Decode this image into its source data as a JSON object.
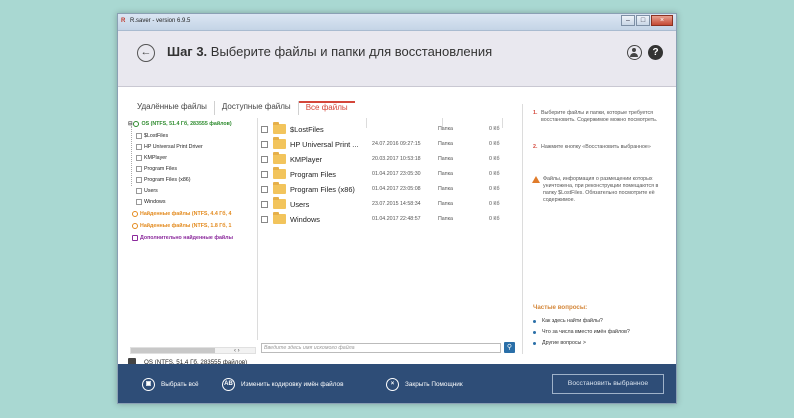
{
  "window": {
    "title": "R.saver - version 6.9.5",
    "logo": "R"
  },
  "header": {
    "step_label": "Шаг 3.",
    "step_text": "Выберите файлы и папки для восстановления"
  },
  "tabs": [
    {
      "label": "Удалённые файлы",
      "active": false
    },
    {
      "label": "Доступные файлы",
      "active": false
    },
    {
      "label": "Все файлы",
      "active": true
    }
  ],
  "tree": {
    "root": "OS (NTFS, 51.4 Гб, 283555 файлов)",
    "children": [
      "$LostFiles",
      "HP Universal Print Driver",
      "KMPlayer",
      "Program Files",
      "Program Files (x86)",
      "Users",
      "Windows"
    ],
    "found1": "Найденные файлы (NTFS, 4.4 Гб, 4",
    "found2": "Найденные файлы (NTFS, 1.8 Гб, 1",
    "extra": "Дополнительно найденные файлы"
  },
  "files": [
    {
      "name": "$LostFiles",
      "date": "",
      "type": "Папка",
      "size": "0 Кб"
    },
    {
      "name": "HP Universal Print ...",
      "date": "24.07.2016 09:27:15",
      "type": "Папка",
      "size": "0 Кб"
    },
    {
      "name": "KMPlayer",
      "date": "20.03.2017 10:53:18",
      "type": "Папка",
      "size": "0 Кб"
    },
    {
      "name": "Program Files",
      "date": "01.04.2017 23:05:30",
      "type": "Папка",
      "size": "0 Кб"
    },
    {
      "name": "Program Files (x86)",
      "date": "01.04.2017 23:05:08",
      "type": "Папка",
      "size": "0 Кб"
    },
    {
      "name": "Users",
      "date": "23.07.2015 14:58:34",
      "type": "Папка",
      "size": "0 Кб"
    },
    {
      "name": "Windows",
      "date": "01.04.2017 22:48:57",
      "type": "Папка",
      "size": "0 Кб"
    }
  ],
  "search": {
    "placeholder": "Введите здесь имя искомого файла",
    "button_icon": "search-icon"
  },
  "scroll": {
    "arrows": "‹  ›"
  },
  "status": {
    "text": "OS (NTFS, 51.4 Гб, 283555 файлов)"
  },
  "help": {
    "step1_num": "1.",
    "step1_text": "Выберите файлы и папки, которые требуется восстановить. Содержимое можно посмотреть.",
    "step2_num": "2.",
    "step2_text": "Нажмите кнопку «Восстановить выбранное»",
    "warning_text": "Файлы, информация о размещении которых уничтожена, при реконструкции помещаются в папку $LostFiles. Обязательно посмотрите её содержимое.",
    "faq_title": "Частые вопросы:",
    "faq": [
      "Как здесь найти файлы?",
      "Что за числа вместо имён файлов?",
      "Другие вопросы >"
    ]
  },
  "footer": {
    "select_all": "Выбрать всё",
    "change_encoding": "Изменить кодировку имён файлов",
    "encoding_icon_text": "AB",
    "close_helper": "Закрыть Помощник",
    "restore": "Восстановить выбранное"
  },
  "colors": {
    "accent": "#d4463a",
    "footer_bg": "#2e4d77",
    "header_bg": "#e9e8ef",
    "folder": "#f2c45c",
    "page_bg": "#a9d8d2"
  }
}
